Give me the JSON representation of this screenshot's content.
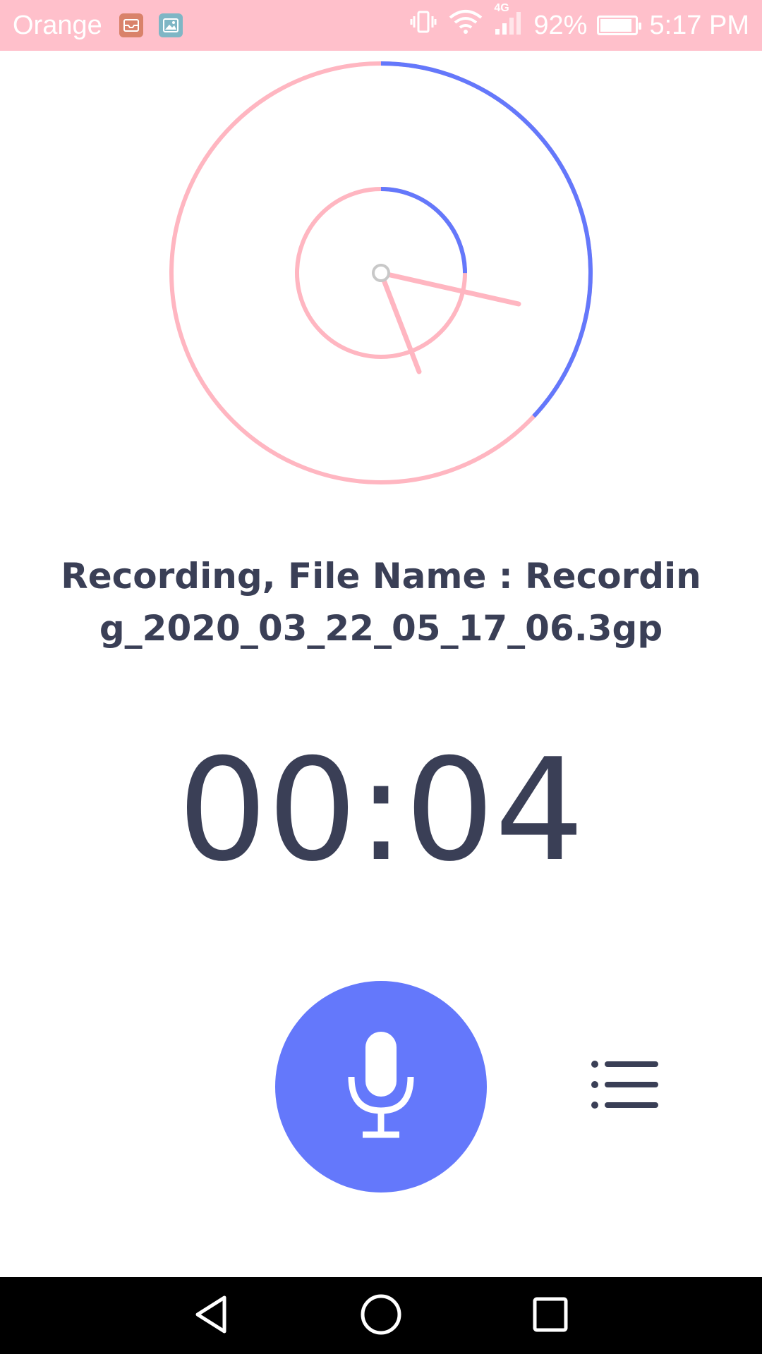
{
  "status_bar": {
    "carrier": "Orange",
    "battery_percent": "92%",
    "battery_level": 0.92,
    "time": "5:17 PM",
    "network_type": "4G",
    "icons": [
      "mail-icon",
      "gallery-icon",
      "vibrate-icon",
      "wifi-icon",
      "signal-icon",
      "battery-icon"
    ],
    "color": "#ffc0cb"
  },
  "recording": {
    "label": "Recording, File Name : Recording_2020_03_22_05_17_06.3gp",
    "timer": "00:04"
  },
  "dial": {
    "outer_progress": 0.37,
    "inner_progress": 0.25,
    "track_color": "#ffb6c1",
    "progress_color": "#6478fb"
  },
  "controls": {
    "record_icon": "microphone-icon",
    "list_icon": "list-icon",
    "accent": "#6478fb"
  },
  "nav_bar": {
    "icons": [
      "back-icon",
      "home-icon",
      "recents-icon"
    ]
  }
}
